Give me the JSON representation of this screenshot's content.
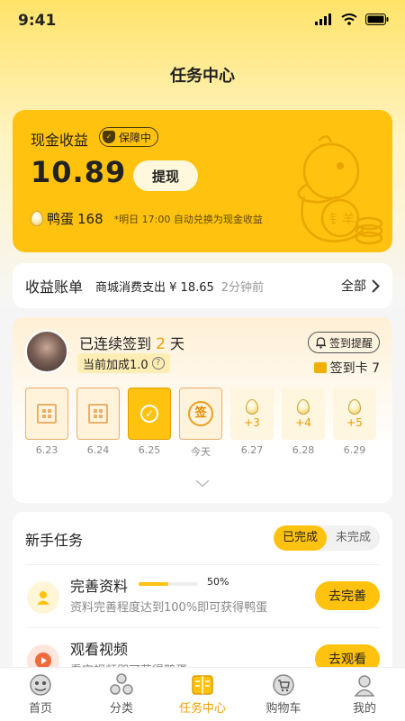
{
  "status": {
    "time": "9:41"
  },
  "header": {
    "title": "任务中心"
  },
  "cash": {
    "label": "现金收益",
    "guard_badge": "保障中",
    "amount": "10.89",
    "withdraw_label": "提现",
    "egg_label": "鸭蛋",
    "egg_count": "168",
    "egg_note": "*明日 17:00 自动兑换为现金收益",
    "duck_text": "钅羊"
  },
  "bill": {
    "title": "收益账单",
    "desc": "商城消费支出 ¥ 18.65",
    "time": "2分钟前",
    "all_label": "全部"
  },
  "checkin": {
    "streak_prefix": "已连续签到",
    "streak_days": "2",
    "streak_suffix": "天",
    "bonus": "当前加成1.0",
    "remind_label": "签到提醒",
    "card_label": "签到卡 7",
    "days": [
      {
        "label": "6.23",
        "state": "past"
      },
      {
        "label": "6.24",
        "state": "past"
      },
      {
        "label": "6.25",
        "state": "done"
      },
      {
        "label": "今天",
        "state": "today",
        "text": "签"
      },
      {
        "label": "6.27",
        "state": "future",
        "reward": "+3"
      },
      {
        "label": "6.28",
        "state": "future",
        "reward": "+4"
      },
      {
        "label": "6.29",
        "state": "future",
        "reward": "+5"
      }
    ]
  },
  "tasks": {
    "title": "新手任务",
    "tab_done": "已完成",
    "tab_todo": "未完成",
    "items": [
      {
        "name": "完善资料",
        "progress_text": "50%",
        "progress": 0.5,
        "desc": "资料完善程度达到100%即可获得鸭蛋",
        "button": "去完善",
        "icon": "user-icon",
        "icon_color": "#ffc20e"
      },
      {
        "name": "观看视频",
        "desc": "看完视频即可获得鸭蛋",
        "button": "去观看",
        "icon": "play-icon",
        "icon_color": "#f06a3a"
      }
    ]
  },
  "tabbar": {
    "items": [
      {
        "label": "首页",
        "icon": "home-icon"
      },
      {
        "label": "分类",
        "icon": "category-icon"
      },
      {
        "label": "任务中心",
        "icon": "task-icon",
        "active": true
      },
      {
        "label": "购物车",
        "icon": "cart-icon"
      },
      {
        "label": "我的",
        "icon": "profile-icon"
      }
    ]
  },
  "colors": {
    "accent": "#ffc20e",
    "highlight": "#f0a000"
  }
}
